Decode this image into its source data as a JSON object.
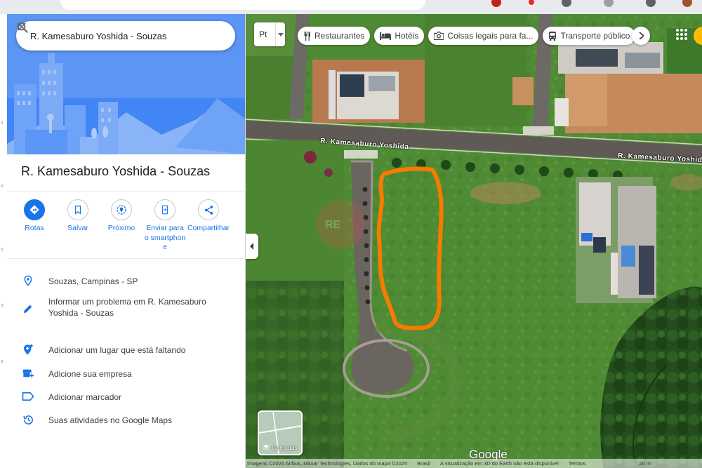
{
  "search": {
    "query": "R. Kamesaburo Yoshida - Souzas"
  },
  "place": {
    "title": "R. Kamesaburo Yoshida - Souzas"
  },
  "actions": [
    {
      "label": "Rotas",
      "icon": "directions-icon"
    },
    {
      "label": "Salvar",
      "icon": "bookmark-icon"
    },
    {
      "label": "Próximo",
      "icon": "nearby-icon"
    },
    {
      "label": "Enviar para o smartphone",
      "icon": "send-to-phone-icon"
    },
    {
      "label": "Compartilhar",
      "icon": "share-icon"
    }
  ],
  "info_rows": [
    {
      "text": "Souzas, Campinas - SP",
      "icon": "location-pin-icon"
    },
    {
      "text": "Informar um problema em R. Kamesaburo Yoshida - Souzas",
      "icon": "edit-pencil-icon"
    },
    {
      "text": "Adicionar um lugar que está faltando",
      "icon": "add-place-icon"
    },
    {
      "text": "Adicione sua empresa",
      "icon": "add-business-icon"
    },
    {
      "text": "Adicionar marcador",
      "icon": "label-icon"
    },
    {
      "text": "Suas atividades no Google Maps",
      "icon": "history-icon"
    }
  ],
  "map": {
    "layer_dropdown_value": "Pt",
    "chips": [
      {
        "label": "Restaurantes",
        "icon": "fork-knife-icon"
      },
      {
        "label": "Hotéis",
        "icon": "bed-icon"
      },
      {
        "label": "Coisas legais para fa...",
        "icon": "camera-icon"
      },
      {
        "label": "Transporte público",
        "icon": "bus-icon"
      }
    ],
    "road_label_1": "R. Kamesaburo Yoshida",
    "road_label_2": "R. Kamesaburo Yoshida",
    "layers_label": "Camadas",
    "logo": "Google",
    "footer": {
      "imagery": "Imagens ©2025 Airbus, Maxar Technologies, Dados do mapa ©2025",
      "country": "Brasil",
      "notice": "A visualização em 3D do Earth não está disponível",
      "terms": "Termos",
      "scale": "20 m"
    },
    "highlight_color": "#f57c00"
  }
}
